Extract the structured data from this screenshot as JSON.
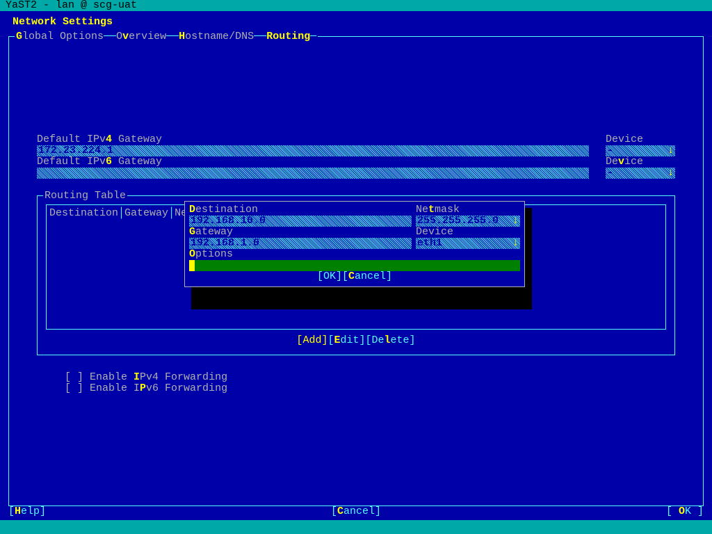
{
  "titlebar": "YaST2 - lan @ scg-uat",
  "page_title": "Network Settings",
  "tabs": {
    "global": "Global Options",
    "overview": "Overview",
    "hostname": "Hostname/DNS",
    "routing": "Routing"
  },
  "gw4": {
    "label_pre": "Default IPv",
    "hot": "4",
    "label_post": " Gateway",
    "value": "172.23.224.1",
    "device_label": "Device"
  },
  "gw6": {
    "label_pre": "Default IPv",
    "hot": "6",
    "label_post": " Gateway",
    "value": "",
    "device_pre": "De",
    "device_hot": "v",
    "device_post": "ice"
  },
  "routing_table": {
    "label": "Routing Table",
    "headers": {
      "dest": "Destination",
      "gw": "Gateway",
      "nm": "Net"
    }
  },
  "dialog": {
    "dest_label_hot": "D",
    "dest_label_post": "estination",
    "dest_value": "192.168.10.0",
    "netmask_pre": "Ne",
    "netmask_hot": "t",
    "netmask_post": "mask",
    "netmask_value": "255.255.255.0",
    "gw_hot": "G",
    "gw_post": "ateway",
    "gw_value": "192.168.1.0",
    "device_label": "Device",
    "device_value": "eth1",
    "opt_hot": "O",
    "opt_post": "ptions",
    "ok": "[OK]",
    "cancel_pre": "[",
    "cancel_hot": "C",
    "cancel_post": "ancel]"
  },
  "route_buttons": {
    "add_pre": "[",
    "add_hot": "A",
    "add_post": "dd]",
    "edit_pre": "[",
    "edit_hot": "E",
    "edit_post": "dit]",
    "del_pre": "[De",
    "del_hot": "l",
    "del_post": "ete]"
  },
  "forwarding": {
    "v4_pre": "[ ] Enable ",
    "v4_hot": "I",
    "v4_post": "Pv4 Forwarding",
    "v6_pre": "[ ] Enable I",
    "v6_hot": "P",
    "v6_post": "v6 Forwarding"
  },
  "bottom": {
    "help_pre": "[",
    "help_hot": "H",
    "help_post": "elp]",
    "cancel_pre": "[",
    "cancel_hot": "C",
    "cancel_post": "ancel]",
    "ok_pre": "[ ",
    "ok_hot": "O",
    "ok_post": "K ]"
  }
}
